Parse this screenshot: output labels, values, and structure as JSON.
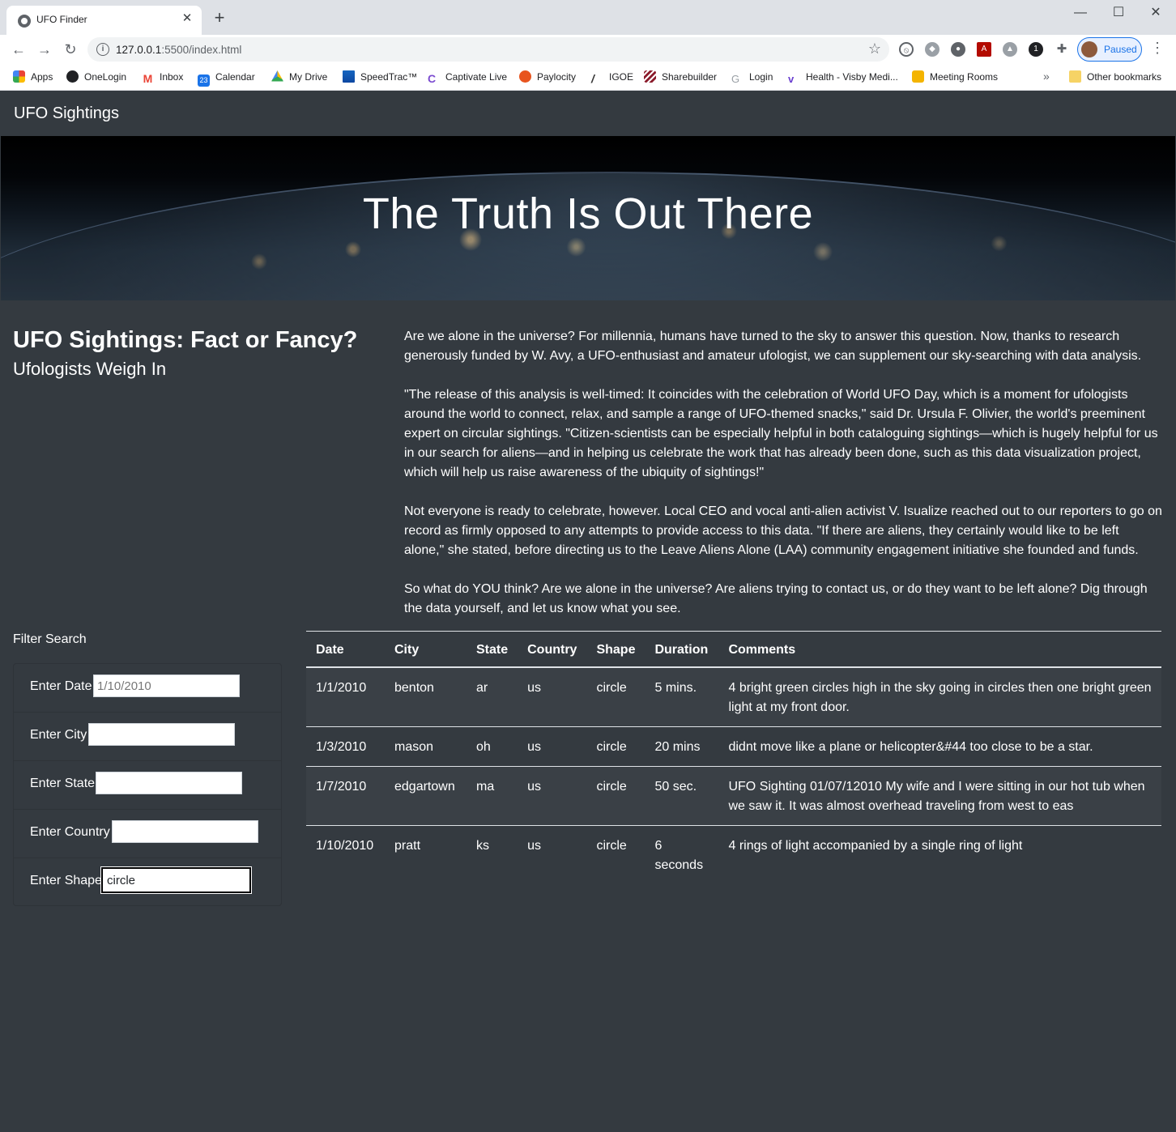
{
  "browser": {
    "tab_title": "UFO Finder",
    "url_host": "127.0.0.1",
    "url_rest": ":5500/index.html",
    "profile_label": "Paused",
    "bookmarks": [
      "Apps",
      "OneLogin",
      "Inbox",
      "Calendar",
      "My Drive",
      "SpeedTrac™",
      "Captivate Live",
      "Paylocity",
      "IGOE",
      "Sharebuilder",
      "Login",
      "Health - Visby Medi...",
      "Meeting Rooms"
    ],
    "other_bookmarks": "Other bookmarks",
    "calendar_badge": "23"
  },
  "nav": {
    "brand": "UFO Sightings"
  },
  "hero": {
    "title": "The Truth Is Out There"
  },
  "article": {
    "title": "UFO Sightings: Fact or Fancy?",
    "subtitle": "Ufologists Weigh In",
    "paragraphs": [
      "Are we alone in the universe? For millennia, humans have turned to the sky to answer this question. Now, thanks to research generously funded by W. Avy, a UFO-enthusiast and amateur ufologist, we can supplement our sky-searching with data analysis.",
      "\"The release of this analysis is well-timed: It coincides with the celebration of World UFO Day, which is a moment for ufologists around the world to connect, relax, and sample a range of UFO-themed snacks,\" said Dr. Ursula F. Olivier, the world's preeminent expert on circular sightings. \"Citizen-scientists can be especially helpful in both cataloguing sightings—which is hugely helpful for us in our search for aliens—and in helping us celebrate the work that has already been done, such as this data visualization project, which will help us raise awareness of the ubiquity of sightings!\"",
      "Not everyone is ready to celebrate, however. Local CEO and vocal anti-alien activist V. Isualize reached out to our reporters to go on record as firmly opposed to any attempts to provide access to this data. \"If there are aliens, they certainly would like to be left alone,\" she stated, before directing us to the Leave Aliens Alone (LAA) community engagement initiative she founded and funds.",
      "So what do YOU think? Are we alone in the universe? Are aliens trying to contact us, or do they want to be left alone? Dig through the data yourself, and let us know what you see."
    ]
  },
  "filters": {
    "title": "Filter Search",
    "date": {
      "label": "Enter Date",
      "placeholder": "1/10/2010",
      "value": ""
    },
    "city": {
      "label": "Enter City",
      "placeholder": "",
      "value": ""
    },
    "state": {
      "label": "Enter State",
      "placeholder": "",
      "value": ""
    },
    "country": {
      "label": "Enter Country",
      "placeholder": "",
      "value": ""
    },
    "shape": {
      "label": "Enter Shape",
      "placeholder": "",
      "value": "circle"
    }
  },
  "table": {
    "headers": [
      "Date",
      "City",
      "State",
      "Country",
      "Shape",
      "Duration",
      "Comments"
    ],
    "rows": [
      [
        "1/1/2010",
        "benton",
        "ar",
        "us",
        "circle",
        "5 mins.",
        "4 bright green circles high in the sky going in circles then one bright green light at my front door."
      ],
      [
        "1/3/2010",
        "mason",
        "oh",
        "us",
        "circle",
        "20 mins",
        "didnt move like a plane or helicopter&#44 too close to be a star."
      ],
      [
        "1/7/2010",
        "edgartown",
        "ma",
        "us",
        "circle",
        "50 sec.",
        "UFO Sighting 01/07/12010 My wife and I were sitting in our hot tub when we saw it. It was almost overhead traveling from west to eas"
      ],
      [
        "1/10/2010",
        "pratt",
        "ks",
        "us",
        "circle",
        "6 seconds",
        "4 rings of light accompanied by a single ring of light"
      ]
    ]
  }
}
